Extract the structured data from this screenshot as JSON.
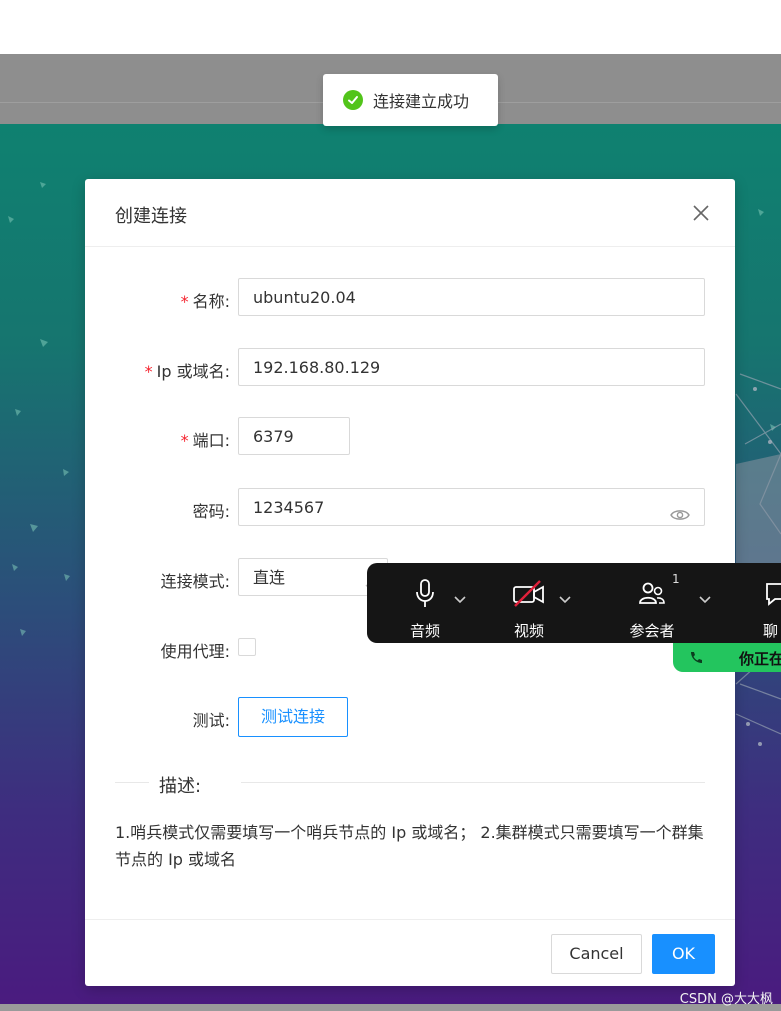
{
  "toast": {
    "message": "连接建立成功"
  },
  "modal": {
    "title": "创建连接",
    "fields": {
      "name": {
        "label": "名称:",
        "value": "ubuntu20.04"
      },
      "host": {
        "label": "Ip 或域名:",
        "value": "192.168.80.129"
      },
      "port": {
        "label": "端口:",
        "value": "6379"
      },
      "password": {
        "label": "密码:",
        "value": "1234567"
      },
      "mode": {
        "label": "连接模式:",
        "value": "直连"
      },
      "proxy": {
        "label": "使用代理:"
      },
      "test": {
        "label": "测试:",
        "button": "测试连接"
      }
    },
    "description": {
      "heading": "描述:",
      "text": "1.哨兵模式仅需要填写一个哨兵节点的 Ip 或域名； 2.集群模式只需要填写一个群集节点的 Ip 或域名"
    },
    "footer": {
      "cancel": "Cancel",
      "ok": "OK"
    }
  },
  "meeting_toolbar": {
    "audio": "音频",
    "video": "视频",
    "participants": "参会者",
    "participants_count": "1",
    "chat": "聊",
    "speaking": "你正在"
  },
  "watermark": "CSDN @大大枫",
  "colors": {
    "primary": "#1890ff",
    "success": "#52c41a",
    "required": "#f5222d"
  }
}
